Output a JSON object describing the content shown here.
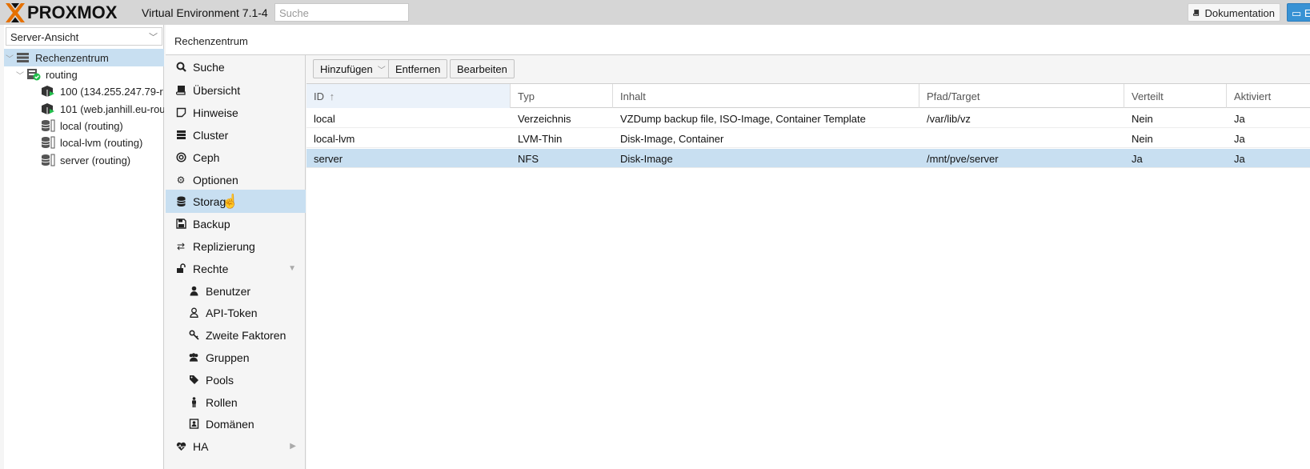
{
  "header": {
    "logo_text": "PROXMOX",
    "version": "Virtual Environment 7.1-4",
    "search_placeholder": "Suche",
    "docs_label": "Dokumentation",
    "create_vm_label": "E"
  },
  "tree": {
    "view_selector": "Server-Ansicht",
    "items": [
      {
        "label": "Rechenzentrum",
        "icon": "datacenter-icon",
        "level": 0,
        "selected": true
      },
      {
        "label": "routing",
        "icon": "node-online-icon",
        "level": 1
      },
      {
        "label": "100 (134.255.247.79-r",
        "icon": "container-running-icon",
        "level": 2
      },
      {
        "label": "101 (web.janhill.eu-rou",
        "icon": "container-running-icon",
        "level": 2
      },
      {
        "label": "local (routing)",
        "icon": "storage-icon",
        "level": 2
      },
      {
        "label": "local-lvm (routing)",
        "icon": "storage-icon",
        "level": 2
      },
      {
        "label": "server (routing)",
        "icon": "storage-icon",
        "level": 2
      }
    ]
  },
  "breadcrumb": "Rechenzentrum",
  "nav": {
    "items": [
      {
        "label": "Suche",
        "icon": "search-icon"
      },
      {
        "label": "Übersicht",
        "icon": "book-icon"
      },
      {
        "label": "Hinweise",
        "icon": "notes-icon"
      },
      {
        "label": "Cluster",
        "icon": "server-icon"
      },
      {
        "label": "Ceph",
        "icon": "ceph-icon"
      },
      {
        "label": "Optionen",
        "icon": "gear-icon"
      },
      {
        "label": "Storage",
        "icon": "database-icon",
        "selected": true
      },
      {
        "label": "Backup",
        "icon": "floppy-icon"
      },
      {
        "label": "Replizierung",
        "icon": "retweet-icon"
      },
      {
        "label": "Rechte",
        "icon": "unlock-icon",
        "expanded": true
      },
      {
        "label": "Benutzer",
        "icon": "user-icon",
        "sub": true
      },
      {
        "label": "API-Token",
        "icon": "user-outline-icon",
        "sub": true
      },
      {
        "label": "Zweite Faktoren",
        "icon": "key-icon",
        "sub": true
      },
      {
        "label": "Gruppen",
        "icon": "users-icon",
        "sub": true
      },
      {
        "label": "Pools",
        "icon": "tags-icon",
        "sub": true
      },
      {
        "label": "Rollen",
        "icon": "male-icon",
        "sub": true
      },
      {
        "label": "Domänen",
        "icon": "address-book-icon",
        "sub": true
      },
      {
        "label": "HA",
        "icon": "heartbeat-icon",
        "collapsed": true
      }
    ]
  },
  "toolbar": {
    "add_label": "Hinzufügen",
    "remove_label": "Entfernen",
    "edit_label": "Bearbeiten"
  },
  "grid": {
    "columns": [
      "ID",
      "Typ",
      "Inhalt",
      "Pfad/Target",
      "Verteilt",
      "Aktiviert"
    ],
    "rows": [
      [
        "local",
        "Verzeichnis",
        "VZDump backup file, ISO-Image, Container Template",
        "/var/lib/vz",
        "Nein",
        "Ja"
      ],
      [
        "local-lvm",
        "LVM-Thin",
        "Disk-Image, Container",
        "",
        "Nein",
        "Ja"
      ],
      [
        "server",
        "NFS",
        "Disk-Image",
        "/mnt/pve/server",
        "Ja",
        "Ja"
      ]
    ],
    "selected_row": 2
  },
  "colors": {
    "accent": "#e57000",
    "selection": "#c8dff1",
    "primary_button": "#3892d4"
  }
}
